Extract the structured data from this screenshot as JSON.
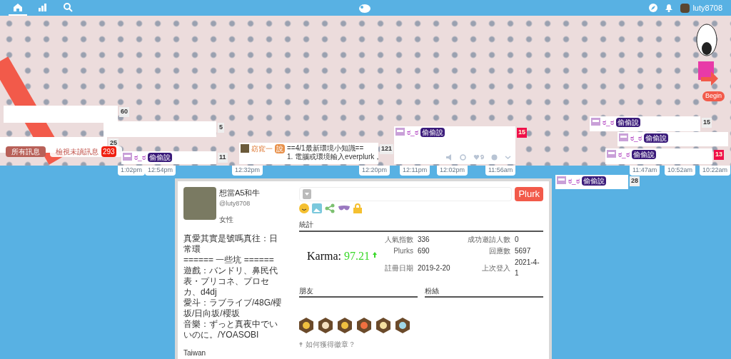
{
  "topbar": {
    "nav": [
      {
        "kind": "home",
        "selected": true
      },
      {
        "kind": "chart",
        "selected": false
      },
      {
        "kind": "search",
        "selected": false
      }
    ],
    "username": "luty8708"
  },
  "timeline": {
    "filters": [
      {
        "label": "所有訊息",
        "selected": true
      },
      {
        "label": "檢視未讀訊息",
        "selected": false,
        "badge": "293"
      }
    ],
    "cards": [
      {
        "kind": "blank",
        "count": "60"
      },
      {
        "kind": "blank",
        "count": "5"
      },
      {
        "kind": "blank",
        "count": "25"
      },
      {
        "kind": "plurk",
        "user": "ಠ_ಠ",
        "qualifier": "偷偷說",
        "count": "11"
      },
      {
        "kind": "post",
        "user": "窈窕一",
        "qualifier": "說",
        "lines": [
          "==4/1最新環境小知識==",
          "1. 電腦或環境輸入everplurk，"
        ],
        "count": "121"
      },
      {
        "kind": "plurk",
        "user": "ಠ_ಠ",
        "qualifier": "偷偷說",
        "count": "15",
        "hot": true,
        "likes": "9"
      },
      {
        "kind": "plurk",
        "user": "ಠ_ಠ",
        "qualifier": "偷偷說",
        "count": "28"
      },
      {
        "kind": "plurk",
        "user": "ಠ_ಠ",
        "qualifier": "偷偷說",
        "count": "15"
      },
      {
        "kind": "plurk",
        "user": "ಠ_ಠ",
        "qualifier": "偷偷說"
      },
      {
        "kind": "plurk",
        "user": "ಠ_ಠ",
        "qualifier": "偷偷說",
        "count": "13",
        "hot": true
      }
    ],
    "times": [
      "1:02pm",
      "12:54pm",
      "12:32pm",
      "12:20pm",
      "12:11pm",
      "12:02pm",
      "11:56am",
      "11:47am",
      "10:52am",
      "10:22am"
    ],
    "begin": "Begin"
  },
  "profile": {
    "display_name": "想當A5和牛",
    "handle": "@luty8708",
    "gender": "女性",
    "bio": [
      "真愛其實是號嗎真往：日常環",
      "====== 一些坑 ======",
      "遊戲：バンドリ、鼻民代表・プリコネ、プロセカ、d4dj",
      "愛斗：ラブライブ/48G/櫻坂/日向坂/櫻坂",
      "音樂：ずっと真夜中でいいのに。/YOASOBI"
    ],
    "location": "Taiwan",
    "post_button": "Plurk",
    "stats_title": "統計",
    "karma_label": "Karma:",
    "karma": "97.21",
    "stats": [
      {
        "label": "人氣指數",
        "value": "336"
      },
      {
        "label": "成功邀請人數",
        "value": "0"
      },
      {
        "label": "Plurks",
        "value": "690"
      },
      {
        "label": "回應數",
        "value": "5697"
      },
      {
        "label": "註冊日期",
        "value": "2019-2-20"
      },
      {
        "label": "上次登入",
        "value": "2021-4-1"
      }
    ],
    "friends_title": "朋友",
    "fans_title": "粉絲",
    "badges": [
      {
        "kind": "eye"
      },
      {
        "kind": "heart"
      },
      {
        "kind": "pencil"
      },
      {
        "kind": "chat"
      },
      {
        "kind": "person"
      },
      {
        "kind": "coin"
      }
    ],
    "badge_help": "如何獲得徽章？"
  }
}
